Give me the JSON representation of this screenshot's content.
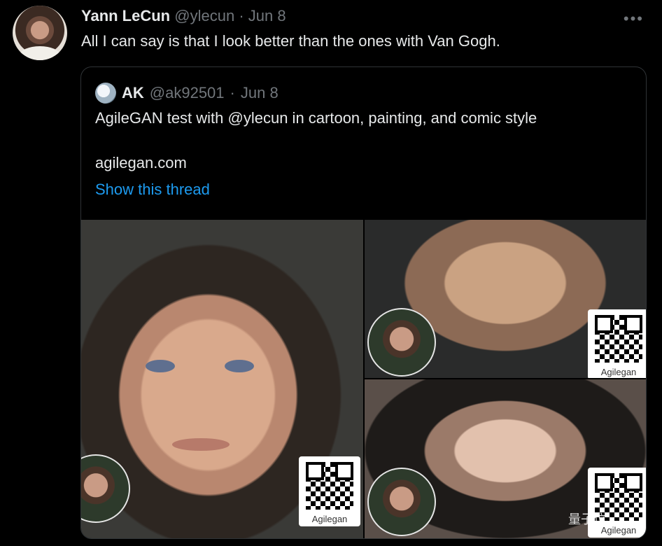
{
  "tweet": {
    "author_name": "Yann LeCun",
    "author_handle": "@ylecun",
    "separator": "·",
    "date": "Jun 8",
    "more_label": "•••",
    "text": "All I can say is that I look better than the ones with Van Gogh."
  },
  "quote": {
    "author_name": "AK",
    "author_handle": "@ak92501",
    "separator": "·",
    "date": "Jun 8",
    "text": "AgileGAN test with @ylecun in cartoon, painting, and comic style",
    "link": "agilegan.com",
    "thread_link": "Show this thread"
  },
  "gallery": {
    "qr_label": "Agilegan"
  },
  "watermark": "量子位"
}
